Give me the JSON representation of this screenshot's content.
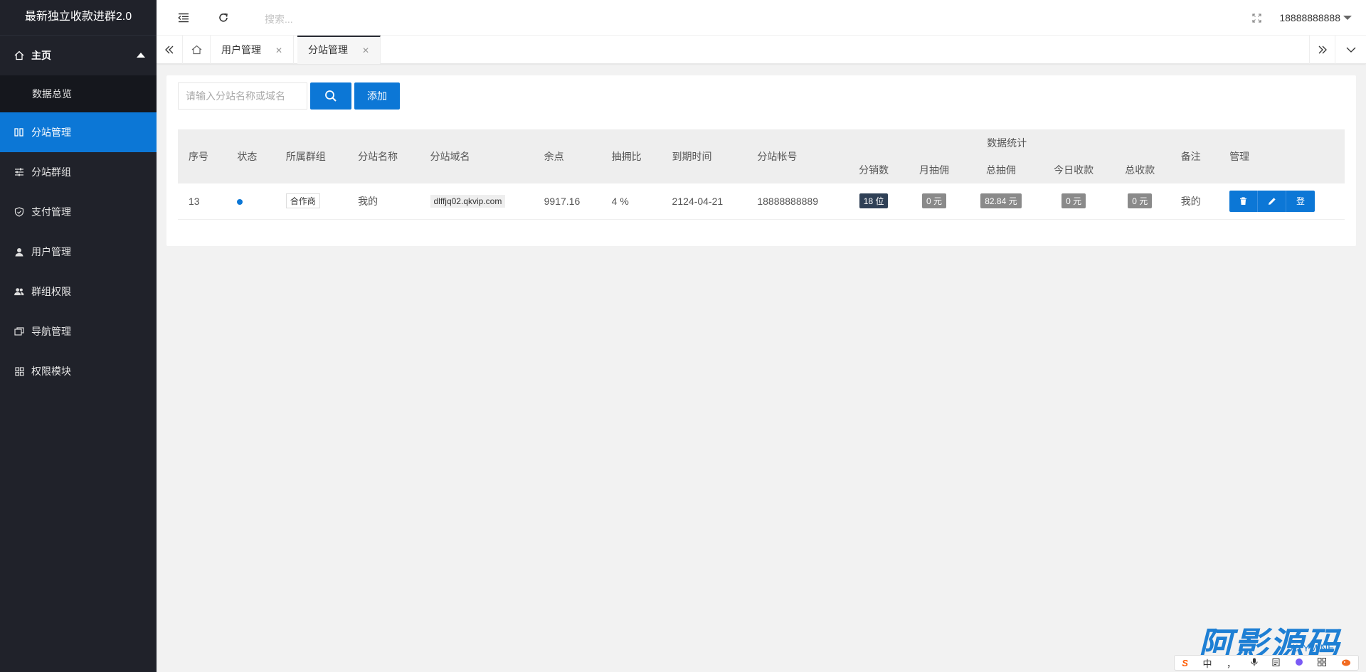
{
  "app": {
    "title": "最新独立收款进群2.0"
  },
  "sidebar": {
    "home_label": "主页",
    "sub_items": [
      {
        "label": "数据总览"
      }
    ],
    "items": [
      {
        "label": "分站管理",
        "icon": "columns-icon"
      },
      {
        "label": "分站群组",
        "icon": "sliders-icon"
      },
      {
        "label": "支付管理",
        "icon": "shield-check-icon"
      },
      {
        "label": "用户管理",
        "icon": "user-icon"
      },
      {
        "label": "群组权限",
        "icon": "users-icon"
      },
      {
        "label": "导航管理",
        "icon": "nav-icon"
      },
      {
        "label": "权限模块",
        "icon": "grid-icon"
      }
    ]
  },
  "header": {
    "search_placeholder": "搜索...",
    "username": "18888888888"
  },
  "tabs": [
    {
      "label": "用户管理"
    },
    {
      "label": "分站管理"
    }
  ],
  "toolbar": {
    "search_placeholder": "请输入分站名称或域名",
    "add_label": "添加"
  },
  "table": {
    "headers": {
      "id": "序号",
      "status": "状态",
      "group": "所属群组",
      "name": "分站名称",
      "domain": "分站域名",
      "balance": "余点",
      "rate": "抽拥比",
      "expire": "到期时间",
      "account": "分站帐号",
      "stats": "数据统计",
      "distributors": "分销数",
      "monthly": "月抽佣",
      "total_comm": "总抽佣",
      "today": "今日收款",
      "total_recv": "总收款",
      "remark": "备注",
      "manage": "管理"
    },
    "rows": [
      {
        "id": "13",
        "group": "合作商",
        "name": "我的",
        "domain": "dlffjq02.qkvip.com",
        "balance": "9917.16",
        "rate": "4 %",
        "expire": "2124-04-21",
        "account": "18888888889",
        "distributors": "18 位",
        "monthly": "0 元",
        "total_comm": "82.84 元",
        "today": "0 元",
        "total_recv": "0 元",
        "remark": "我的",
        "login_label": "登"
      }
    ]
  },
  "watermark": {
    "text": "阿影源码",
    "sub": "AYYM.NET"
  },
  "ime": {
    "lang": "中",
    "punct": "，"
  },
  "colors": {
    "accent": "#0c77d6",
    "sidebar": "#20222a",
    "badge_dark": "#2f4056",
    "badge_gray": "#8a8a8a"
  }
}
